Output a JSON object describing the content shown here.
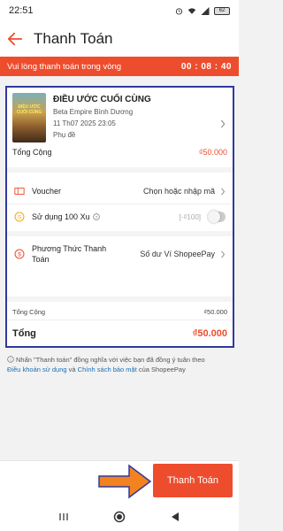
{
  "status": {
    "time": "22:51",
    "battery": "62"
  },
  "header": {
    "title": "Thanh Toán"
  },
  "timer": {
    "label": "Vui lòng thanh toán trong vòng",
    "value": "00 : 08 : 40"
  },
  "movie": {
    "title": "ĐIỀU ƯỚC CUỐI CÙNG",
    "cinema": "Beta Empire Bình Dương",
    "datetime": "11 Th07 2025 23:05",
    "subtitle": "Phụ đề",
    "poster_text": "ĐIỀU ƯỚC CUỐI CÙNG"
  },
  "total": {
    "label": "Tổng Cộng",
    "value": "₫50.000"
  },
  "voucher": {
    "label": "Voucher",
    "value": "Chọn hoặc nhập mã"
  },
  "xu": {
    "label": "Sử dụng 100 Xu",
    "value": "[-₫100]",
    "enabled": false
  },
  "payment": {
    "label": "Phương Thức Thanh Toán",
    "value": "Số dư Ví ShopeePay"
  },
  "summary": {
    "subtotal_label": "Tổng Cộng",
    "subtotal_value": "₫50.000",
    "total_label": "Tổng",
    "total_value": "₫50.000"
  },
  "terms": {
    "text1": "Nhấn \"Thanh toán\" đồng nghĩa với việc bạn đã đồng ý tuân theo",
    "link1": "Điều khoản sử dụng",
    "and": " và ",
    "link2": "Chính sách bảo mật",
    "text2": " của ShopeePay"
  },
  "actions": {
    "pay_label": "Thanh Toán"
  },
  "colors": {
    "accent": "#ee4d2d",
    "highlight_border": "#2e3a9c",
    "annotation_arrow": "#f58220",
    "link": "#1a6fb5"
  },
  "icons": [
    "back-arrow-icon",
    "wifi-icon",
    "signal-icon",
    "battery-icon",
    "chevron-right-icon",
    "voucher-ticket-icon",
    "coin-icon",
    "info-icon",
    "payment-method-icon",
    "nav-menu-icon",
    "nav-home-icon",
    "nav-back-icon"
  ]
}
